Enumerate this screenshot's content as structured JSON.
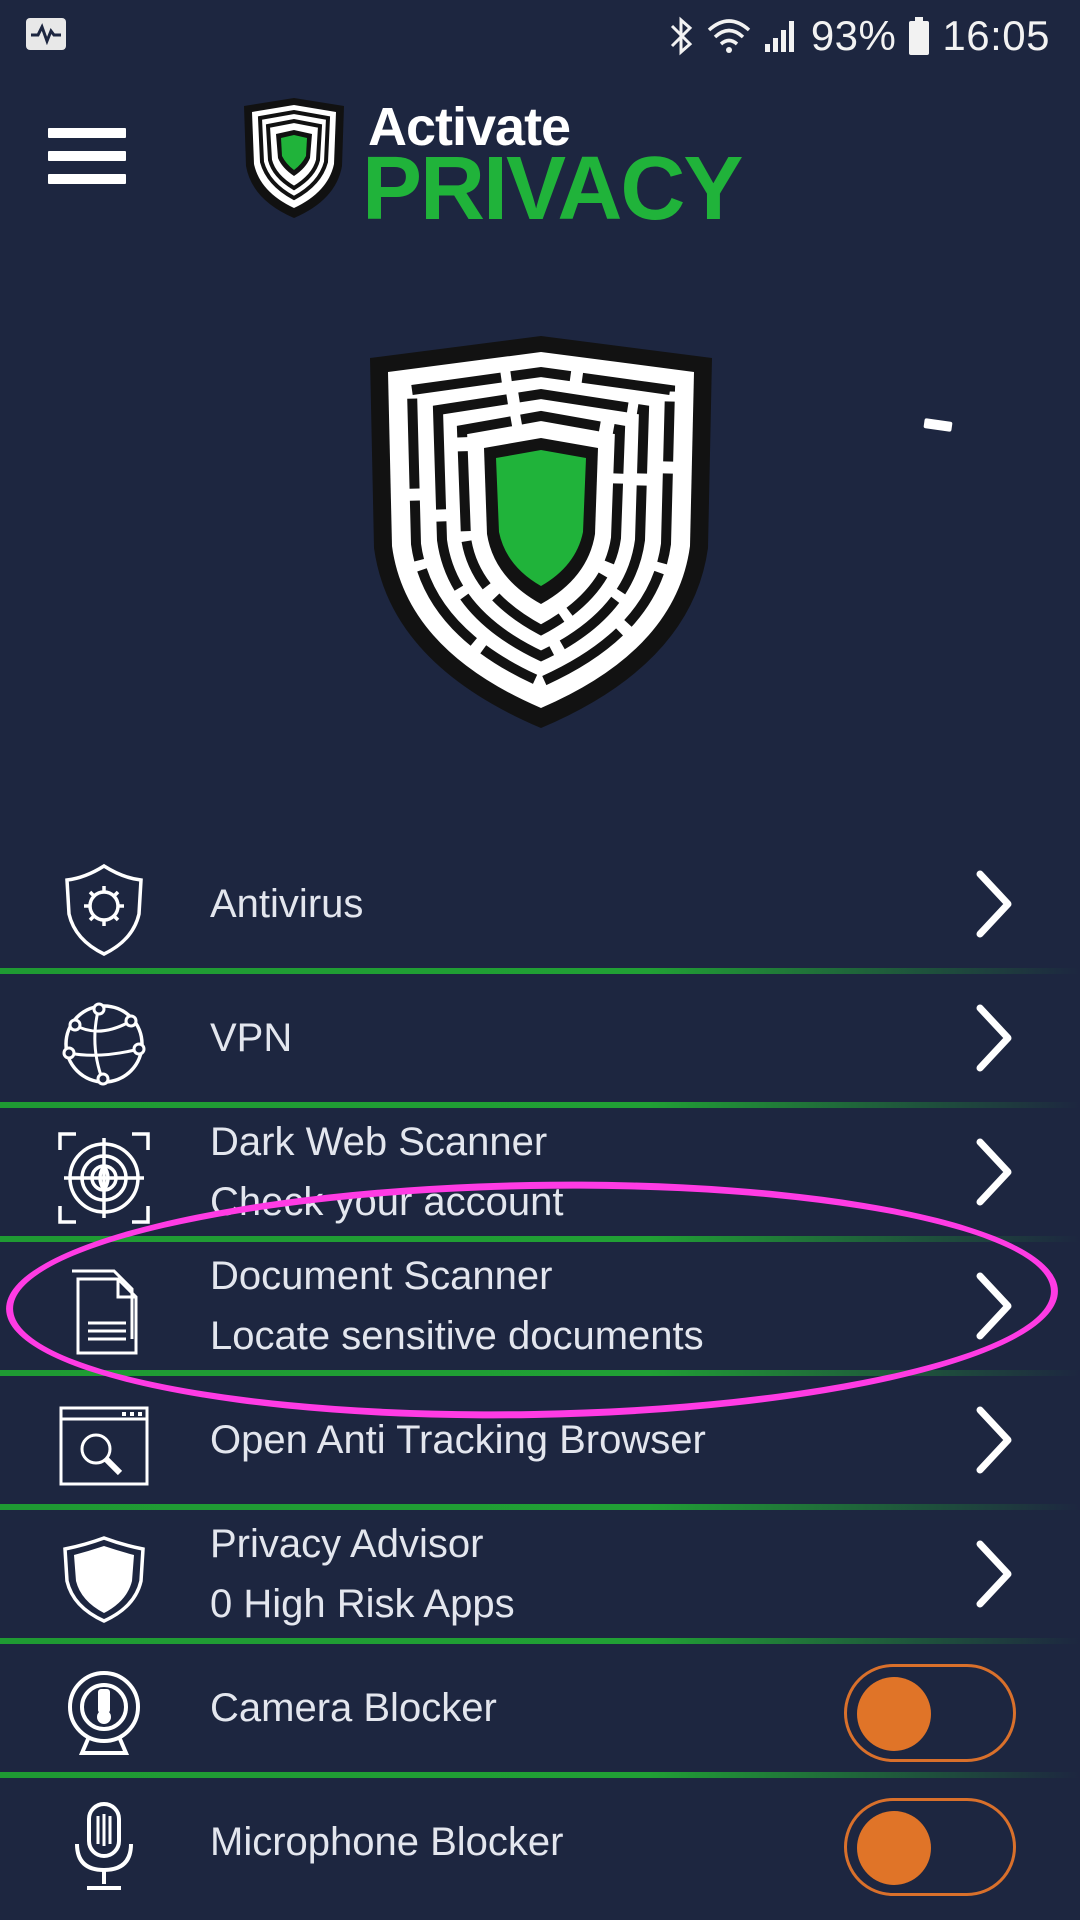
{
  "status_bar": {
    "battery": "93%",
    "time": "16:05",
    "icons": [
      "activity-icon",
      "bluetooth-icon",
      "wifi-icon",
      "signal-icon",
      "battery-icon"
    ]
  },
  "header": {
    "menu_icon": "hamburger-menu-icon",
    "logo_top": "Activate",
    "logo_bottom": "PRIVACY"
  },
  "colors": {
    "background": "#1d2640",
    "brand_green": "#20b33a",
    "toggle_orange": "#e07428",
    "highlight_magenta": "#ff3be4"
  },
  "menu": {
    "items": [
      {
        "title": "Antivirus",
        "subtitle": "",
        "icon": "antivirus-shield-icon",
        "control": "chevron"
      },
      {
        "title": "VPN",
        "subtitle": "",
        "icon": "vpn-globe-icon",
        "control": "chevron"
      },
      {
        "title": "Dark Web Scanner",
        "subtitle": "Check your account",
        "icon": "dark-web-target-icon",
        "control": "chevron"
      },
      {
        "title": "Document Scanner",
        "subtitle": "Locate sensitive documents",
        "icon": "document-icon",
        "control": "chevron"
      },
      {
        "title": "Open Anti Tracking Browser",
        "subtitle": "",
        "icon": "browser-search-icon",
        "control": "chevron"
      },
      {
        "title": "Privacy Advisor",
        "subtitle": "0 High Risk Apps",
        "icon": "privacy-shield-icon",
        "control": "chevron"
      },
      {
        "title": "Camera Blocker",
        "subtitle": "",
        "icon": "webcam-icon",
        "control": "toggle"
      },
      {
        "title": "Microphone Blocker",
        "subtitle": "",
        "icon": "microphone-icon",
        "control": "toggle"
      }
    ]
  }
}
